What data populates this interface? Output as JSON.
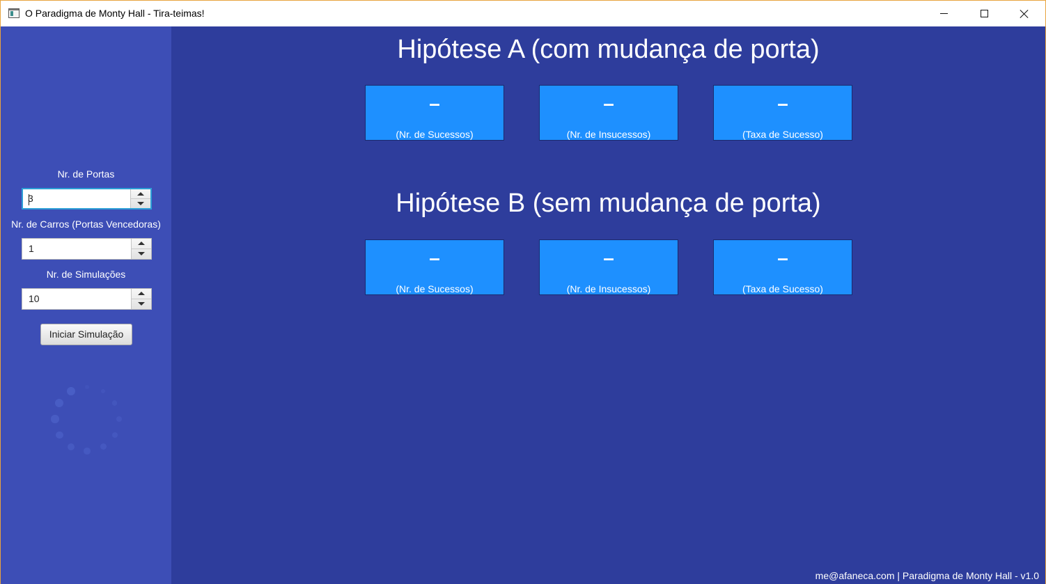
{
  "window": {
    "title": "O Paradigma de Monty Hall - Tira-teimas!",
    "icon": "app-window-icon",
    "controls": [
      "minimize-icon",
      "maximize-icon",
      "close-icon"
    ]
  },
  "sidebar": {
    "doors": {
      "label": "Nr. de Portas",
      "value": "3"
    },
    "cars": {
      "label": "Nr. de Carros (Portas Vencedoras)",
      "value": "1"
    },
    "simulations": {
      "label": "Nr. de Simulações",
      "value": "10"
    },
    "start_button": "Iniciar Simulação",
    "loading_icon": "spinner-icon"
  },
  "hypothesis_a": {
    "title": "Hipótese A (com mudança de porta)",
    "cards": [
      {
        "value": "–",
        "label": "(Nr. de Sucessos)"
      },
      {
        "value": "–",
        "label": "(Nr. de Insucessos)"
      },
      {
        "value": "–",
        "label": "(Taxa de Sucesso)"
      }
    ]
  },
  "hypothesis_b": {
    "title": "Hipótese B (sem mudança de porta)",
    "cards": [
      {
        "value": "–",
        "label": "(Nr. de Sucessos)"
      },
      {
        "value": "–",
        "label": "(Nr. de Insucessos)"
      },
      {
        "value": "–",
        "label": "(Taxa de Sucesso)"
      }
    ]
  },
  "footer": {
    "text": "me@afaneca.com | Paradigma de Monty Hall - v1.0"
  },
  "colors": {
    "sidebar_bg": "#3d4eb6",
    "main_bg": "#2e3d9c",
    "card_bg": "#1e90ff",
    "focus_border": "#2d9fd6",
    "window_border": "#e8a33d"
  }
}
